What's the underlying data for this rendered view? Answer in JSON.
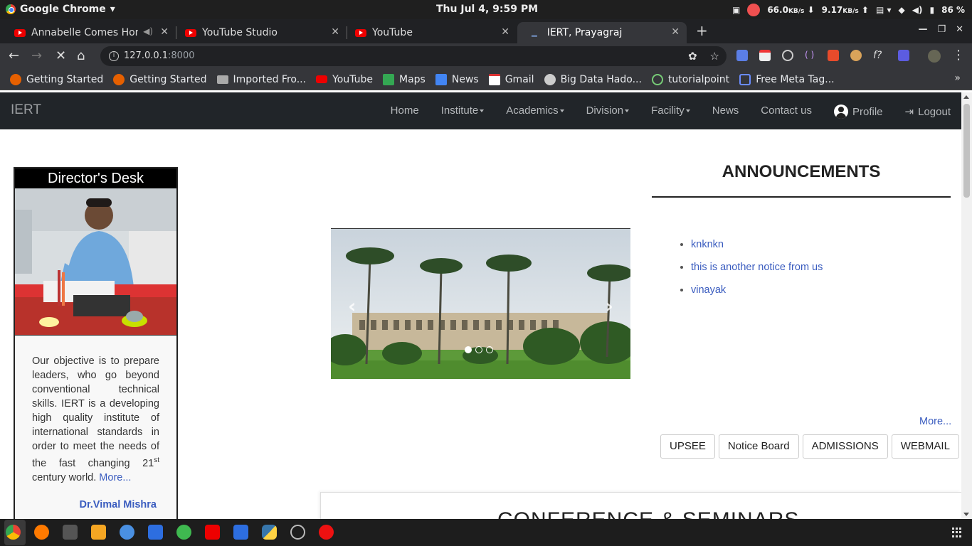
{
  "os": {
    "app_name": "Google Chrome",
    "clock": "Thu Jul  4,  9:59 PM",
    "net_down": "66.0",
    "net_down_unit": "KB/s",
    "net_up": "9.17",
    "net_up_unit": "KB/s",
    "battery": "86 %"
  },
  "tabs": [
    {
      "title": "Annabelle Comes Hom",
      "favicon": "youtube-icon"
    },
    {
      "title": "YouTube Studio",
      "favicon": "youtube-icon"
    },
    {
      "title": "YouTube",
      "favicon": "youtube-icon"
    },
    {
      "title": "IERT, Prayagraj",
      "favicon": "loading-icon",
      "active": true
    }
  ],
  "address_bar": {
    "host": "127.0.0.1",
    "port": ":8000"
  },
  "bookmarks": [
    {
      "label": "Getting Started",
      "icon": "firefox-icon"
    },
    {
      "label": "Getting Started",
      "icon": "firefox-icon"
    },
    {
      "label": "Imported Fro...",
      "icon": "folder-icon"
    },
    {
      "label": "YouTube",
      "icon": "youtube-icon"
    },
    {
      "label": "Maps",
      "icon": "maps-icon"
    },
    {
      "label": "News",
      "icon": "news-icon"
    },
    {
      "label": "Gmail",
      "icon": "gmail-icon"
    },
    {
      "label": "Big Data Hado...",
      "icon": "globe-icon"
    },
    {
      "label": "tutorialpoint",
      "icon": "tutorialpoint-icon"
    },
    {
      "label": "Free Meta Tag...",
      "icon": "link-icon"
    }
  ],
  "site": {
    "brand": "IERT",
    "nav": {
      "home": "Home",
      "institute": "Institute",
      "academics": "Academics",
      "division": "Division",
      "facility": "Facility",
      "news": "News",
      "contact": "Contact us",
      "profile": "Profile",
      "logout": "Logout"
    },
    "director": {
      "heading": "Director's Desk",
      "message": "Our objective is to prepare leaders, who go beyond conventional technical skills. IERT is a developing high quality institute of international standards in order to meet the needs of the fast changing 21",
      "sup": "st",
      "message_end": " century world. ",
      "more": "More...",
      "name": "Dr.Vimal Mishra"
    },
    "carousel": {
      "slide_count": 3,
      "active_index": 0
    },
    "announcements": {
      "title": "ANNOUNCEMENTS",
      "items": [
        "knknkn",
        "this is another notice from us",
        "vinayak"
      ],
      "more": "More..."
    },
    "buttons": {
      "upsee": "UPSEE",
      "notice": "Notice Board",
      "admissions": "ADMISSIONS",
      "webmail": "WEBMAIL"
    },
    "conference_title": "CONFERENCE & SEMINARS"
  },
  "colors": {
    "link": "#3a5cbf",
    "navbar": "#212529"
  }
}
